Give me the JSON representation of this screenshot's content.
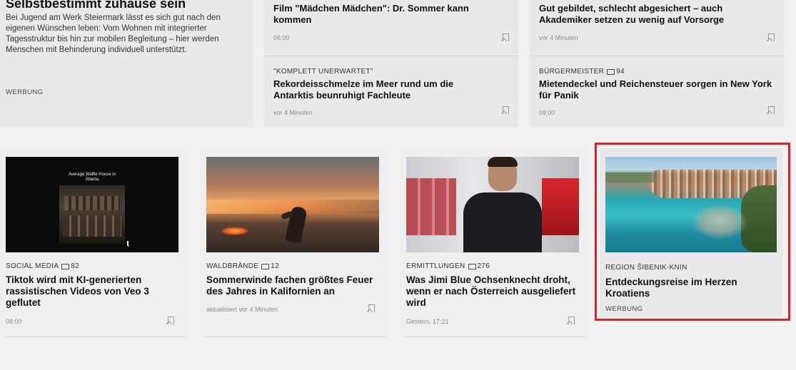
{
  "promo_left": {
    "title": "Selbstbestimmt zuhause sein",
    "text": "Bei Jugend am Werk Steiermark lässt es sich gut nach den eigenen Wünschen leben: Vom Wohnen mit integrierter Tagesstruktur bis hin zur mobilen Begleitung – hier werden Menschen mit Behinderung individuell unterstützt.",
    "label": "WERBUNG"
  },
  "top_col2": [
    {
      "title": "Film \"Mädchen Mädchen\": Dr. Sommer kann kommen",
      "time": "06:00"
    },
    {
      "kicker": "\"KOMPLETT UNERWARTET\"",
      "title": "Rekordeisschmelze im Meer rund um die Antarktis beunruhigt Fachleute",
      "time": "vor 4 Minuten"
    }
  ],
  "top_col3": [
    {
      "title": "Gut gebildet, schlecht abgesichert – auch Akademiker setzen zu wenig auf Vorsorge",
      "time": "vor 4 Minuten"
    },
    {
      "kicker": "BÜRGERMEISTER",
      "comments": "94",
      "title": "Mietendeckel und Reichensteuer sorgen in New York für Panik",
      "time": "08:00"
    }
  ],
  "cards": [
    {
      "image_text": "Average Waffle House in Atlanta",
      "kicker": "SOCIAL MEDIA",
      "comments": "82",
      "title": "Tiktok wird mit KI-generierten rassistischen Videos von Veo 3 geflutet",
      "time": "08:00"
    },
    {
      "kicker": "WALDBRÄNDE",
      "comments": "12",
      "title": "Sommerwinde fachen größtes Feuer des Jahres in Kalifornien an",
      "time": "aktualisiert vor 4 Minuten"
    },
    {
      "kicker": "ERMITTLUNGEN",
      "comments": "276",
      "title": "Was Jimi Blue Ochsenknecht droht, wenn er nach Österreich ausgeliefert wird",
      "time": "Gestern, 17:21"
    },
    {
      "kicker": "REGION ŠIBENIK-KNIN",
      "title": "Entdeckungsreise im Herzen Kroatiens",
      "label": "WERBUNG"
    }
  ],
  "colors": {
    "highlight": "#e0202a",
    "background": "#f1f1f1",
    "card": "#e9e9e9"
  }
}
